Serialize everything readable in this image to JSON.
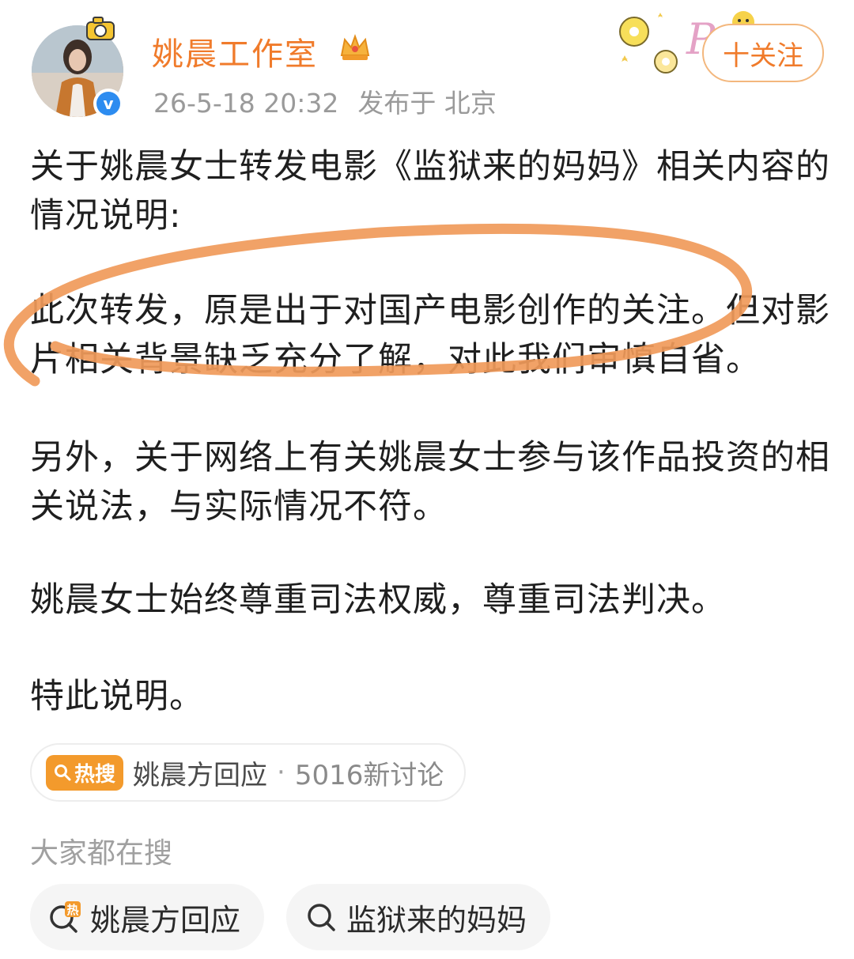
{
  "header": {
    "account_name": "姚晨工作室",
    "timestamp": "26-5-18 20:32",
    "location": "发布于 北京",
    "follow_label": "十关注",
    "verified_icon": "v",
    "crown_icon": "crown-icon"
  },
  "post": {
    "paragraphs": [
      "关于姚晨女士转发电影《监狱来的妈妈》相关内容的情况说明:",
      "此次转发，原是出于对国产电影创作的关注。但对影片相关背景缺乏充分了解，对此我们审慎自省。",
      "另外，关于网络上有关姚晨女士参与该作品投资的相关说法，与实际情况不符。",
      "姚晨女士始终尊重司法权威，尊重司法判决。",
      "特此说明。"
    ]
  },
  "hot_search": {
    "badge": "热搜",
    "topic": "姚晨方回应",
    "separator": "·",
    "count": "5016新讨论"
  },
  "related": {
    "label": "大家都在搜",
    "items": [
      {
        "label": "姚晨方回应",
        "icon": "hot-search-icon"
      },
      {
        "label": "监狱来的妈妈",
        "icon": "search-icon"
      }
    ]
  },
  "colors": {
    "accent": "#f07b2b",
    "annotation": "#f09a5a",
    "verified": "#2d8cf0",
    "hot_badge": "#f39a2c"
  }
}
